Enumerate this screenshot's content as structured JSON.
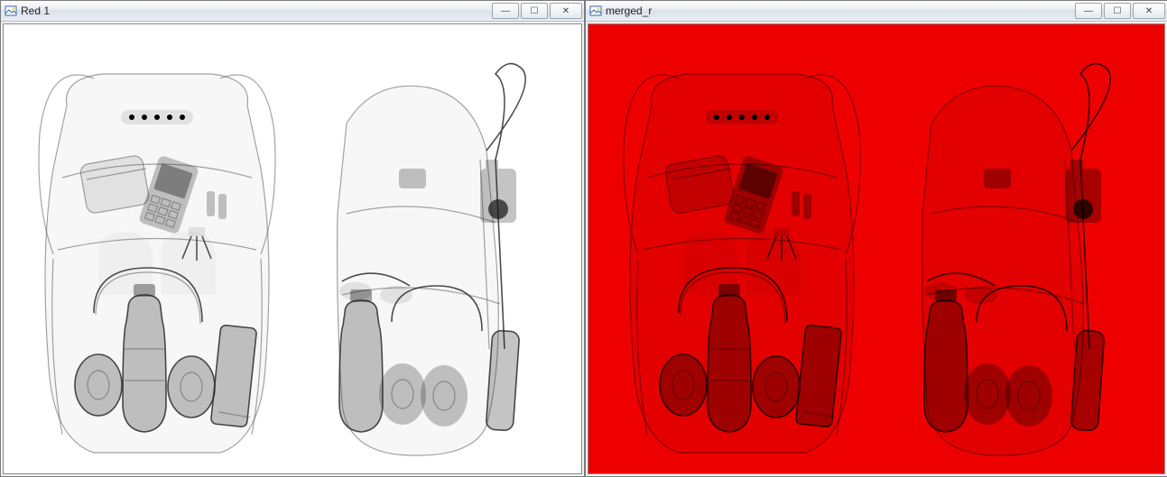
{
  "windows": [
    {
      "id": "left",
      "title": "Red 1",
      "icon": "image-viewer-icon",
      "controls": {
        "minimize": "—",
        "maximize": "☐",
        "close": "✕"
      },
      "content": {
        "kind": "xray-grayscale",
        "description": "Grayscale X-ray scan of a backpack, front and side views",
        "objects_front": [
          "backpack-outline",
          "top-handle",
          "straps",
          "small-pouch",
          "phone",
          "batteries",
          "tripod-mini",
          "headphones",
          "water-bottle",
          "power-bank"
        ],
        "objects_side": [
          "backpack-side-outline",
          "strap-loop",
          "camera",
          "sunglasses",
          "water-bottle",
          "headphones",
          "cylinder"
        ]
      }
    },
    {
      "id": "right",
      "title": "merged_r",
      "icon": "image-viewer-icon",
      "controls": {
        "minimize": "—",
        "maximize": "☐",
        "close": "✕"
      },
      "content": {
        "kind": "xray-red-channel",
        "description": "Same backpack scan rendered over solid red background (red channel merge)",
        "objects_front": [
          "backpack-outline",
          "top-handle",
          "straps",
          "small-pouch",
          "phone",
          "batteries",
          "tripod-mini",
          "headphones",
          "water-bottle",
          "power-bank"
        ],
        "objects_side": [
          "backpack-side-outline",
          "strap-loop",
          "camera",
          "sunglasses",
          "water-bottle",
          "headphones",
          "cylinder"
        ]
      }
    }
  ]
}
